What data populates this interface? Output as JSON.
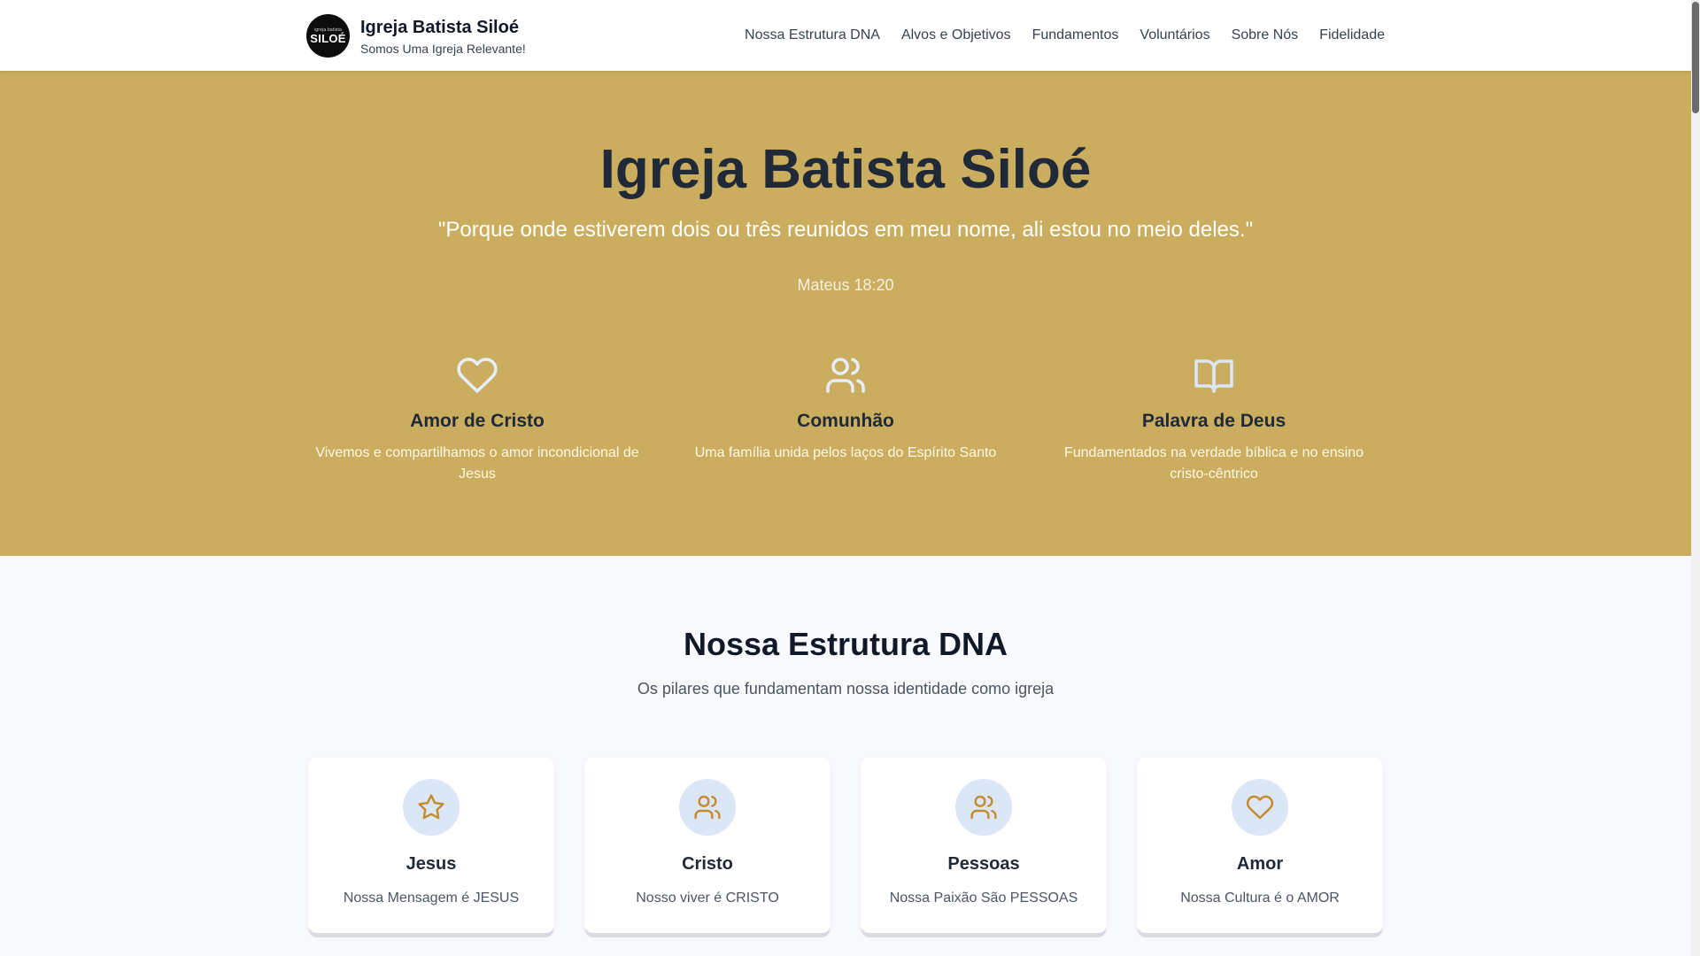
{
  "header": {
    "logo": {
      "small_text": "igreja batista",
      "main_text": "SILOÉ"
    },
    "title": "Igreja Batista Siloé",
    "tagline": "Somos Uma Igreja Relevante!",
    "nav": [
      {
        "label": "Nossa Estrutura DNA"
      },
      {
        "label": "Alvos e Objetivos"
      },
      {
        "label": "Fundamentos"
      },
      {
        "label": "Voluntários"
      },
      {
        "label": "Sobre Nós"
      },
      {
        "label": "Fidelidade"
      }
    ]
  },
  "hero": {
    "background_color": "#cbad5f",
    "title": "Igreja Batista Siloé",
    "verse": "\"Porque onde estiverem dois ou três reunidos em meu nome, ali estou no meio deles.\"",
    "reference": "Mateus 18:20",
    "features": [
      {
        "icon": "heart-icon",
        "title": "Amor de Cristo",
        "description": "Vivemos e compartilhamos o amor incondicional de Jesus"
      },
      {
        "icon": "users-icon",
        "title": "Comunhão",
        "description": "Uma família unida pelos laços do Espírito Santo"
      },
      {
        "icon": "book-open-icon",
        "title": "Palavra de Deus",
        "description": "Fundamentados na verdade bíblica e no ensino cristo-cêntrico"
      }
    ]
  },
  "dna": {
    "title": "Nossa Estrutura DNA",
    "subtitle": "Os pilares que fundamentam nossa identidade como igreja",
    "icon_color": "#c48a2c",
    "icon_bg": "#dbe6f7",
    "cards": [
      {
        "icon": "star-icon",
        "title": "Jesus",
        "description": "Nossa Mensagem é JESUS"
      },
      {
        "icon": "users-icon",
        "title": "Cristo",
        "description": "Nosso viver é CRISTO"
      },
      {
        "icon": "users-icon",
        "title": "Pessoas",
        "description": "Nossa Paixão São PESSOAS"
      },
      {
        "icon": "heart-icon",
        "title": "Amor",
        "description": "Nossa Cultura é o AMOR"
      }
    ]
  }
}
